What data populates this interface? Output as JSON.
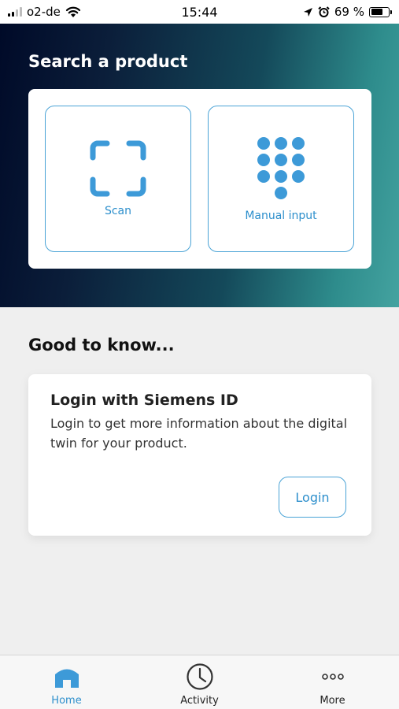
{
  "status_bar": {
    "carrier": "o2-de",
    "time": "15:44",
    "battery_percent": "69 %",
    "battery_level": 0.69
  },
  "search": {
    "title": "Search a product",
    "tiles": [
      {
        "label": "Scan",
        "icon": "scan-frame-icon"
      },
      {
        "label": "Manual input",
        "icon": "keypad-icon"
      }
    ]
  },
  "good_to_know": {
    "title": "Good to know...",
    "card": {
      "title": "Login with Siemens ID",
      "text": "Login to get more information about the digital twin for your product.",
      "button_label": "Login"
    }
  },
  "tab_bar": {
    "tabs": [
      {
        "label": "Home",
        "icon": "home-icon",
        "active": true
      },
      {
        "label": "Activity",
        "icon": "clock-icon",
        "active": false
      },
      {
        "label": "More",
        "icon": "more-dots-icon",
        "active": false
      }
    ]
  },
  "colors": {
    "accent": "#2d8fcc",
    "tile_border": "#4aa3d6",
    "keypad_dot": "#3d9ad8",
    "hero_dark": "#000a28",
    "hero_teal": "#44a3a0"
  }
}
